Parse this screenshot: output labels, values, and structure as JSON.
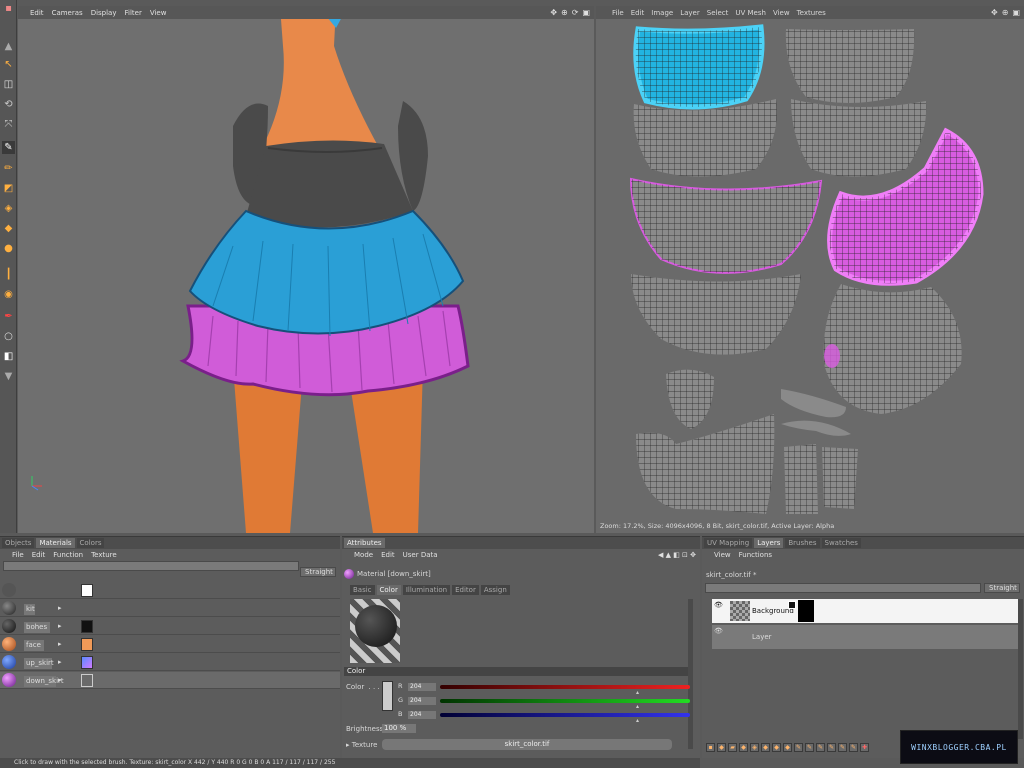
{
  "viewport": {
    "menu": [
      "Edit",
      "Cameras",
      "Display",
      "Filter",
      "View"
    ]
  },
  "uv_editor": {
    "menu": [
      "File",
      "Edit",
      "Image",
      "Layer",
      "Select",
      "UV Mesh",
      "View",
      "Textures"
    ],
    "status": "Zoom: 17.2%, Size: 4096x4096, 8 Bit, skirt_color.tif, Active Layer: Alpha"
  },
  "objects_panel": {
    "tabs": [
      "Objects",
      "Materials",
      "Colors"
    ],
    "active_tab": "Materials",
    "menu": [
      "File",
      "Edit",
      "Function",
      "Texture"
    ],
    "dropdown": "Straight",
    "materials": [
      {
        "name": "",
        "ball": "#555555",
        "swatch": "#ffffff"
      },
      {
        "name": "kit",
        "ball": "#3a3a3a",
        "swatch": "#6a6a6a"
      },
      {
        "name": "bohes",
        "ball": "#2a2a2a",
        "swatch": "#111111"
      },
      {
        "name": "face",
        "ball": "#e8894a",
        "swatch": "#f09a58"
      },
      {
        "name": "up_skirt",
        "ball": "#3b6ad8",
        "swatch": "#8866ff"
      },
      {
        "name": "down_skirt",
        "ball": "#c050d8",
        "swatch": "#6a6a6a"
      }
    ]
  },
  "attributes_panel": {
    "tabs": [
      "Attributes"
    ],
    "menu": [
      "Mode",
      "Edit",
      "User Data"
    ],
    "material_title": "Material [down_skirt]",
    "subtabs": [
      "Basic",
      "Color",
      "Illumination",
      "Editor",
      "Assign"
    ],
    "active_subtab": "Color",
    "section": "Color",
    "color_label": "Color",
    "r_label": "R",
    "r_value": "204",
    "g_label": "G",
    "g_value": "204",
    "b_label": "B",
    "b_value": "204",
    "brightness_label": "Brightness",
    "brightness_value": "100 %",
    "texture_label": "Texture",
    "texture_value": "skirt_color.tif"
  },
  "layers_panel": {
    "tabs": [
      "UV Mapping",
      "Layers",
      "Brushes",
      "Swatches"
    ],
    "active_tab": "Layers",
    "menu": [
      "View",
      "Functions"
    ],
    "file": "skirt_color.tif *",
    "dropdown": "Straight",
    "layers": [
      {
        "name": "Background"
      },
      {
        "name": "Layer"
      }
    ]
  },
  "statusbar": {
    "text": "Click to draw with the selected brush. Texture: skirt_color   X 442 / Y 440 R 0 G 0 B 0 A 117 / 117 / 117 / 255"
  },
  "watermark": "WINXBLOGGER.CBA.PL",
  "colors": {
    "skin": "#e8894a",
    "skirt_top": "#2a9fd6",
    "skirt_bottom": "#d05cd8",
    "waistband": "#4a4a4a"
  }
}
